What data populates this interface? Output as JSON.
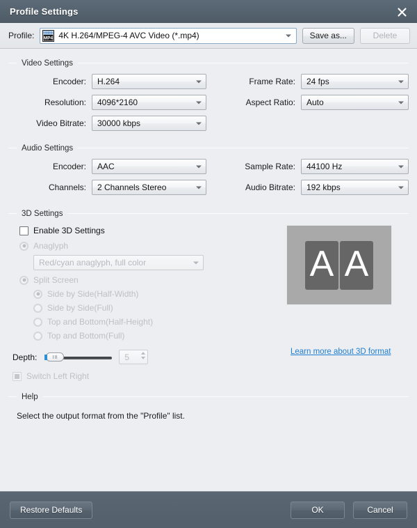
{
  "window": {
    "title": "Profile Settings",
    "close_icon": "close-icon"
  },
  "profile_bar": {
    "label": "Profile:",
    "icon": "mp4-file-icon",
    "value": "4K H.264/MPEG-4 AVC Video (*.mp4)",
    "save_as_label": "Save as...",
    "delete_label": "Delete"
  },
  "video_settings": {
    "title": "Video Settings",
    "encoder_label": "Encoder:",
    "encoder_value": "H.264",
    "frame_rate_label": "Frame Rate:",
    "frame_rate_value": "24 fps",
    "resolution_label": "Resolution:",
    "resolution_value": "4096*2160",
    "aspect_ratio_label": "Aspect Ratio:",
    "aspect_ratio_value": "Auto",
    "video_bitrate_label": "Video Bitrate:",
    "video_bitrate_value": "30000 kbps"
  },
  "audio_settings": {
    "title": "Audio Settings",
    "encoder_label": "Encoder:",
    "encoder_value": "AAC",
    "sample_rate_label": "Sample Rate:",
    "sample_rate_value": "44100 Hz",
    "channels_label": "Channels:",
    "channels_value": "2 Channels Stereo",
    "audio_bitrate_label": "Audio Bitrate:",
    "audio_bitrate_value": "192 kbps"
  },
  "three_d_settings": {
    "title": "3D Settings",
    "enable_label": "Enable 3D Settings",
    "anaglyph_label": "Anaglyph",
    "anaglyph_value": "Red/cyan anaglyph, full color",
    "split_screen_label": "Split Screen",
    "split_options": [
      "Side by Side(Half-Width)",
      "Side by Side(Full)",
      "Top and Bottom(Half-Height)",
      "Top and Bottom(Full)"
    ],
    "depth_label": "Depth:",
    "depth_value": "5",
    "switch_left_right_label": "Switch Left Right",
    "learn_more_label": "Learn more about 3D format",
    "preview_left_letter": "A",
    "preview_right_letter": "A"
  },
  "help": {
    "title": "Help",
    "text": "Select the output format from the \"Profile\" list."
  },
  "footer": {
    "restore_defaults_label": "Restore Defaults",
    "ok_label": "OK",
    "cancel_label": "Cancel"
  },
  "colors": {
    "titlebar": "#55636f",
    "body": "#eceef1",
    "footer": "#55626e",
    "link": "#1f7fd0",
    "accent_blue": "#2f8fd6"
  }
}
